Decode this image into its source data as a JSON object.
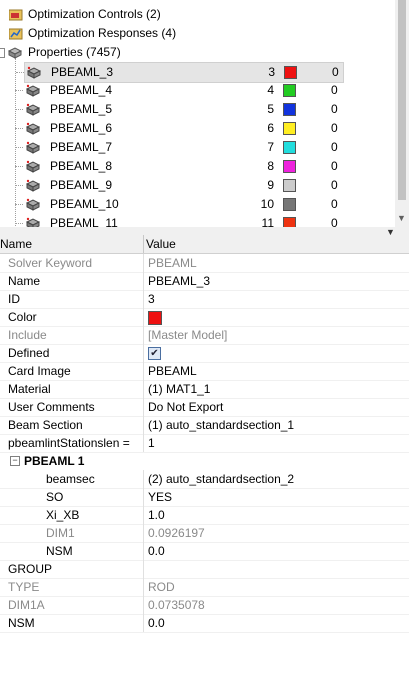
{
  "tree": {
    "folders": [
      {
        "label": "Optimization Controls (2)",
        "icon": "optimization-controls-icon"
      },
      {
        "label": "Optimization Responses (4)",
        "icon": "optimization-responses-icon"
      },
      {
        "label": "Properties (7457)",
        "icon": "properties-icon"
      }
    ],
    "properties": [
      {
        "name": "PBEAML_3",
        "id": "3",
        "color": "#ee1111",
        "count": "0"
      },
      {
        "name": "PBEAML_4",
        "id": "4",
        "color": "#22cc22",
        "count": "0"
      },
      {
        "name": "PBEAML_5",
        "id": "5",
        "color": "#1133dd",
        "count": "0"
      },
      {
        "name": "PBEAML_6",
        "id": "6",
        "color": "#ffee22",
        "count": "0"
      },
      {
        "name": "PBEAML_7",
        "id": "7",
        "color": "#22dddd",
        "count": "0"
      },
      {
        "name": "PBEAML_8",
        "id": "8",
        "color": "#ee22dd",
        "count": "0"
      },
      {
        "name": "PBEAML_9",
        "id": "9",
        "color": "#cccccc",
        "count": "0"
      },
      {
        "name": "PBEAML_10",
        "id": "10",
        "color": "#777777",
        "count": "0"
      },
      {
        "name": "PBEAML_11",
        "id": "11",
        "color": "#ee3311",
        "count": "0"
      }
    ]
  },
  "grid": {
    "col_name": "Name",
    "col_value": "Value",
    "rows": [
      {
        "key": "Solver Keyword",
        "value": "PBEAML",
        "muted": true
      },
      {
        "key": "Name",
        "value": "PBEAML_3"
      },
      {
        "key": "ID",
        "value": "3"
      },
      {
        "key": "Color",
        "value": ""
      },
      {
        "key": "Include",
        "value": "[Master Model]",
        "muted": true
      },
      {
        "key": "Defined",
        "value": ""
      },
      {
        "key": "Card Image",
        "value": "PBEAML"
      },
      {
        "key": "Material",
        "value": "(1) MAT1_1"
      },
      {
        "key": "User Comments",
        "value": "Do Not Export"
      },
      {
        "key": "Beam Section",
        "value": "(1) auto_standardsection_1"
      },
      {
        "key": "pbeamlintStationslen =",
        "value": "1"
      }
    ],
    "section_title": "PBEAML 1",
    "section_rows": [
      {
        "key": "beamsec",
        "value": "(2) auto_standardsection_2"
      },
      {
        "key": "SO",
        "value": "YES"
      },
      {
        "key": "Xi_XB",
        "value": "1.0"
      },
      {
        "key": "DIM1",
        "value": "0.0926197",
        "muted": true
      },
      {
        "key": "NSM",
        "value": "0.0"
      }
    ],
    "tail_rows": [
      {
        "key": "GROUP",
        "value": ""
      },
      {
        "key": "TYPE",
        "value": "ROD",
        "muted": true
      },
      {
        "key": "DIM1A",
        "value": "0.0735078",
        "muted": true
      },
      {
        "key": "NSM",
        "value": "0.0"
      }
    ],
    "color_value": "#ee1111",
    "defined_checked": true
  }
}
